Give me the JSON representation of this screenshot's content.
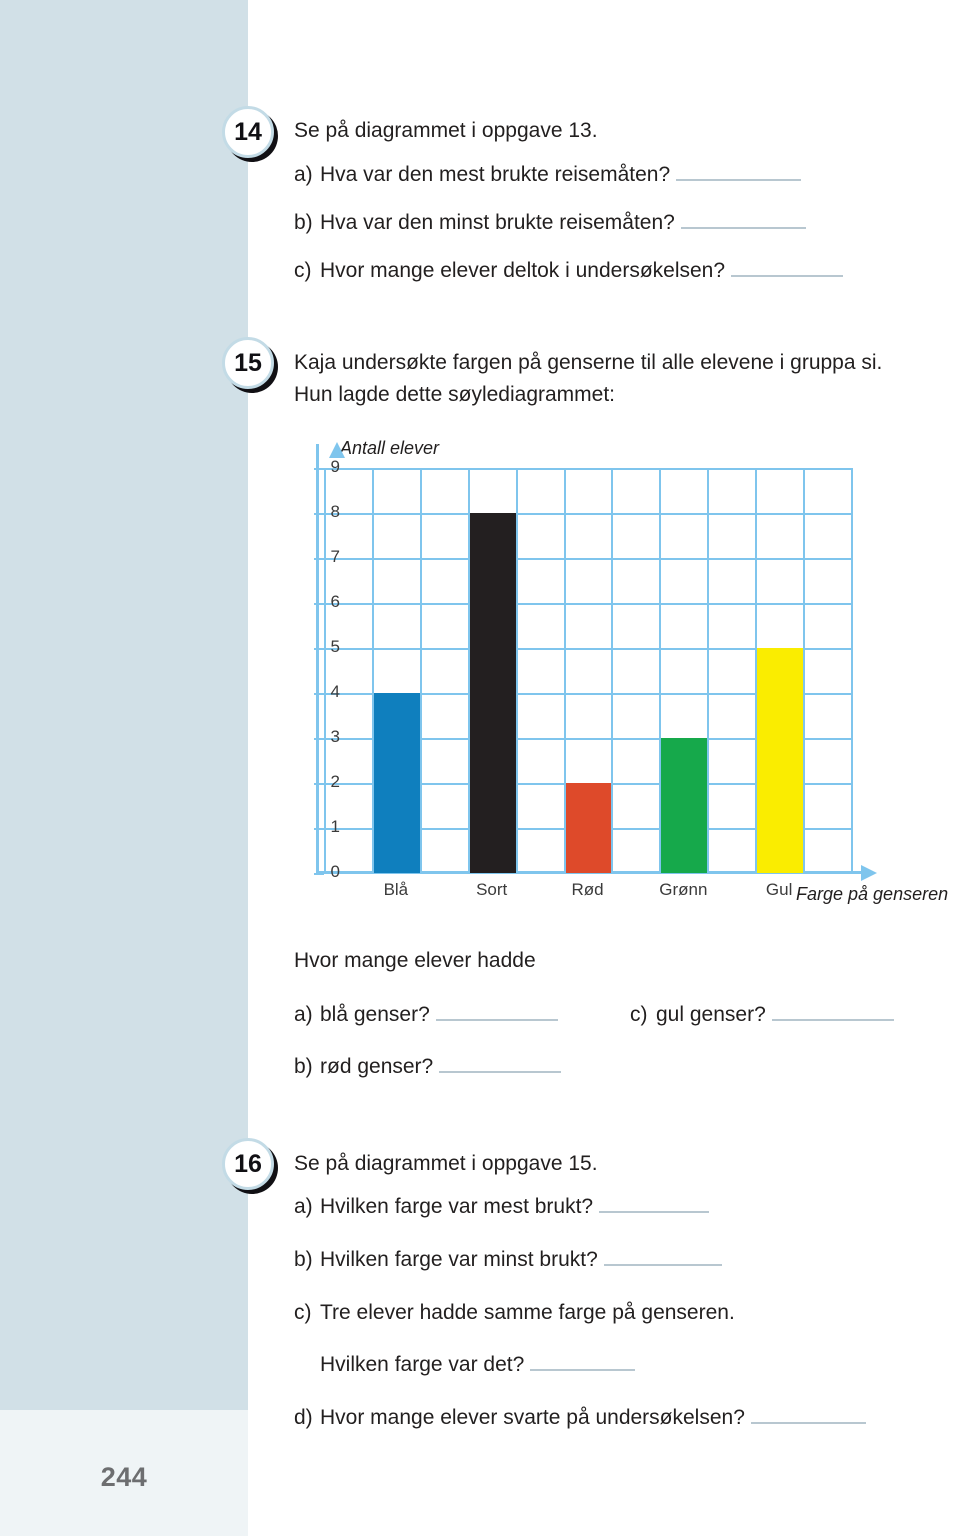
{
  "page": {
    "number": "244"
  },
  "tasks": [
    {
      "badge": "14",
      "intro": "Se på diagrammet i oppgave 13.",
      "items": [
        {
          "marker": "a)",
          "text": "Hva var den mest brukte reisemåten?"
        },
        {
          "marker": "b)",
          "text": "Hva var den minst brukte reisemåten?"
        },
        {
          "marker": "c)",
          "text": "Hvor mange elever deltok i undersøkelsen?"
        }
      ]
    },
    {
      "badge": "15",
      "intro_line1": "Kaja undersøkte fargen på genserne til alle elevene i gruppa si.",
      "intro_line2": "Hun lagde dette søylediagrammet:",
      "prompt": "Hvor mange elever hadde",
      "items": [
        {
          "marker": "a)",
          "text": "blå genser?"
        },
        {
          "marker": "b)",
          "text": "rød genser?"
        },
        {
          "marker": "c)",
          "text": "gul genser?"
        }
      ]
    },
    {
      "badge": "16",
      "intro": "Se på diagrammet i oppgave 15.",
      "items": [
        {
          "marker": "a)",
          "text": "Hvilken farge var mest brukt?"
        },
        {
          "marker": "b)",
          "text": "Hvilken farge var minst brukt?"
        },
        {
          "marker": "c)",
          "text": "Tre elever hadde samme farge på genseren."
        },
        {
          "marker": "",
          "text": "Hvilken farge var det?"
        },
        {
          "marker": "d)",
          "text": "Hvor mange elever svarte på undersøkelsen?"
        }
      ]
    }
  ],
  "chart_data": {
    "type": "bar",
    "title": "",
    "xlabel": "Farge på genseren",
    "ylabel": "Antall elever",
    "categories": [
      "Blå",
      "Sort",
      "Rød",
      "Grønn",
      "Gul"
    ],
    "values": [
      4,
      8,
      2,
      3,
      5
    ],
    "colors": [
      "#0f7fbe",
      "#231f20",
      "#de4a2a",
      "#16a94b",
      "#faed00"
    ],
    "ylim": [
      0,
      9
    ],
    "yticks": [
      "0",
      "1",
      "2",
      "3",
      "4",
      "5",
      "6",
      "7",
      "8",
      "9"
    ],
    "grid": true,
    "legend": "none",
    "grid_color": "#7fc5ed",
    "axis_color": "#7fc5ed"
  },
  "colors": {
    "sidebar": "#d1e0e7",
    "sidebar_foot": "#eff4f6",
    "answer_line": "#b8c7d0",
    "text": "#221f1f",
    "page_number": "#6d6e70"
  }
}
